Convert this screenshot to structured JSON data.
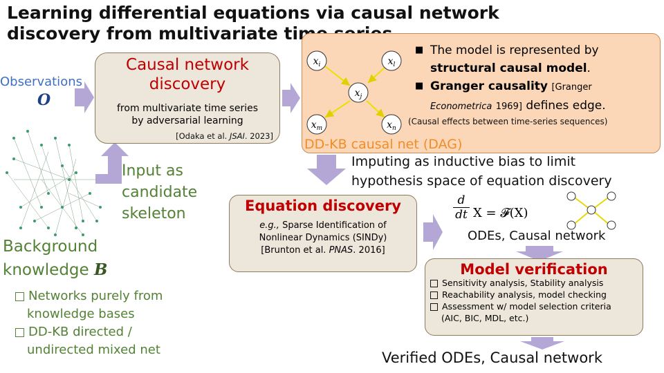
{
  "title": "Learning differential equations via causal network discovery from multivariate time series",
  "observations": {
    "label": "Observations",
    "symbol": "O"
  },
  "causal_discovery": {
    "title": "Causal network discovery",
    "lines": [
      "from multivariate time series",
      "by adversarial learning"
    ],
    "ref_prefix": "[Odaka et al. ",
    "ref_journal": "JSAI",
    "ref_suffix": ". 2023]"
  },
  "input_label": [
    "Input as",
    "candidate",
    "skeleton"
  ],
  "background": {
    "line1": "Background",
    "line2": "knowledge",
    "symbol": "B",
    "items": [
      [
        "Networks purely from",
        "knowledge bases"
      ],
      [
        "DD-KB directed /",
        "undirected mixed net"
      ]
    ]
  },
  "dd_kb": {
    "label": "DD-KB causal net (DAG)",
    "nodes": [
      "x_i",
      "x_l",
      "x_j",
      "x_m",
      "x_n"
    ],
    "bullet1_pre": "The model is represented by",
    "bullet1_bold": "structural causal model",
    "bullet1_end": ".",
    "bullet2_bold": "Granger causality",
    "bullet2_ref": "[Granger",
    "bullet2_journal": "Econometrica",
    "bullet2_ref2": "1969]",
    "bullet2_end": "defines edge.",
    "note": "(Causal effects between time-series sequences)"
  },
  "imputing": [
    "Imputing as inductive bias to limit",
    "hypothesis space of equation discovery"
  ],
  "equation_discovery": {
    "title": "Equation discovery",
    "eg": "e.g.,",
    "line1": "Sparse Identification of",
    "line2": "Nonlinear Dynamics (SINDy)",
    "ref_prefix": "[Brunton et al. ",
    "ref_journal": "PNAS",
    "ref_suffix": ". 2016]"
  },
  "ode": {
    "d": "d",
    "dt": "dt",
    "rhs": "X  = 𝓕(X)",
    "label": "ODEs, Causal network"
  },
  "model_verification": {
    "title": "Model verification",
    "items": [
      "Sensitivity analysis, Stability analysis",
      "Reachability analysis, model checking",
      "Assessment w/ model selection criteria",
      "(AIC, BIC, MDL, etc.)"
    ]
  },
  "verified": "Verified ODEs, Causal network",
  "colors": {
    "red": "#c00000",
    "green": "#538135",
    "orange": "#f28c28",
    "blue": "#3f6fc0",
    "arrow": "#b4a7d6"
  }
}
